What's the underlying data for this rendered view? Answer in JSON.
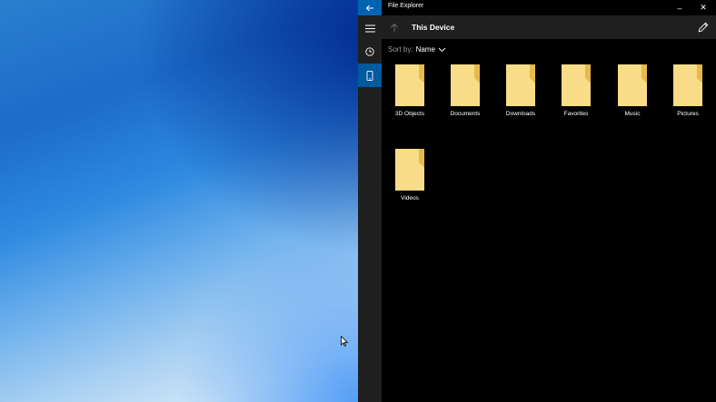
{
  "window": {
    "title": "File Explorer",
    "minimize_glyph": "–",
    "close_glyph": "✕"
  },
  "nav": {
    "items": [
      "hamburger-menu",
      "recent",
      "this-device"
    ]
  },
  "header": {
    "location": "This Device"
  },
  "sort": {
    "label": "Sort by:",
    "value": "Name",
    "chevron": "⌄"
  },
  "folders": [
    {
      "name": "3D Objects"
    },
    {
      "name": "Documents"
    },
    {
      "name": "Downloads"
    },
    {
      "name": "Favorites"
    },
    {
      "name": "Music"
    },
    {
      "name": "Pictures"
    },
    {
      "name": "Videos"
    }
  ],
  "colors": {
    "accent": "#0063b1",
    "selected_nav": "#005a9e",
    "folder": "#f7d67a"
  }
}
